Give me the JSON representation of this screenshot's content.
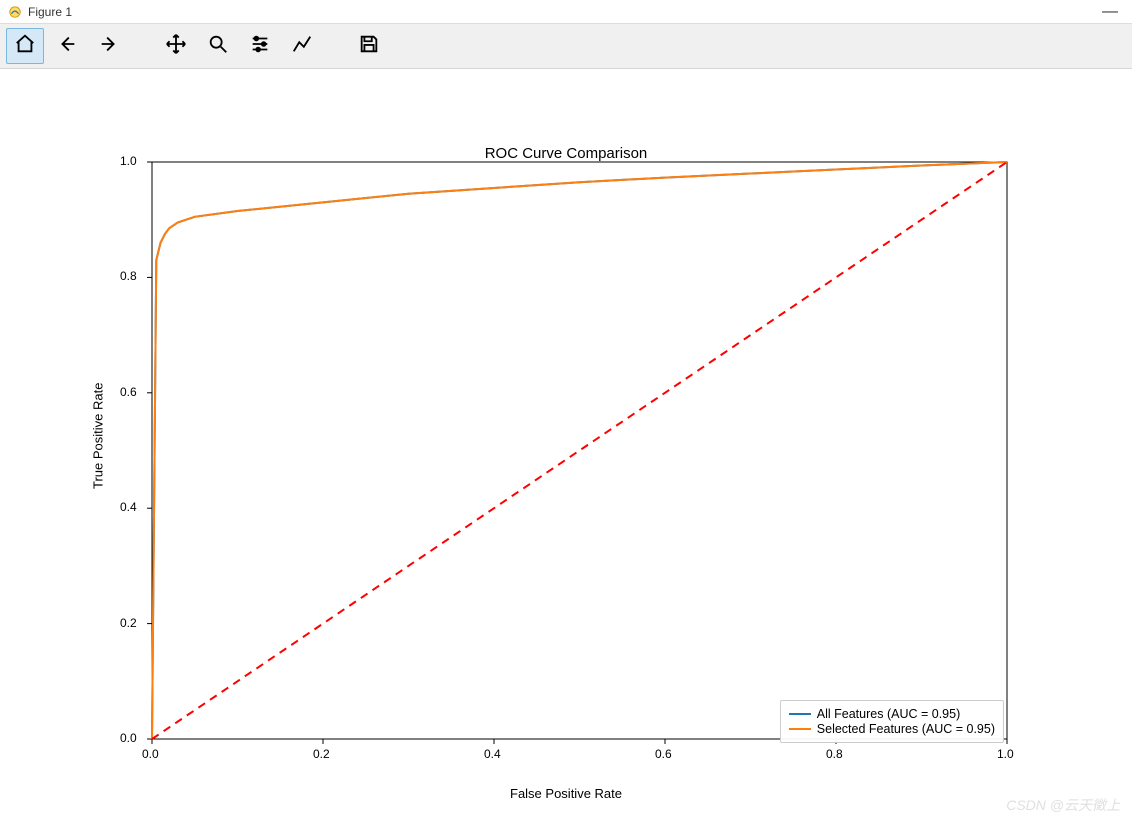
{
  "window": {
    "title": "Figure 1"
  },
  "toolbar": {
    "home": "Home",
    "back": "Back",
    "forward": "Forward",
    "pan": "Pan",
    "zoom": "Zoom",
    "configure": "Configure subplots",
    "edit": "Edit axes",
    "save": "Save"
  },
  "watermark": "CSDN @云天徵上",
  "chart_data": {
    "type": "line",
    "title": "ROC Curve Comparison",
    "xlabel": "False Positive Rate",
    "ylabel": "True Positive Rate",
    "xlim": [
      0.0,
      1.0
    ],
    "ylim": [
      0.0,
      1.0
    ],
    "xticks": [
      0.0,
      0.2,
      0.4,
      0.6,
      0.8,
      1.0
    ],
    "yticks": [
      0.0,
      0.2,
      0.4,
      0.6,
      0.8,
      1.0
    ],
    "series": [
      {
        "name": "All Features (AUC = 0.95)",
        "color": "#1f77b4",
        "style": "solid",
        "x": [
          0.0,
          0.005,
          0.01,
          0.015,
          0.02,
          0.03,
          0.05,
          0.1,
          0.2,
          0.3,
          0.4,
          0.5,
          0.6,
          0.7,
          0.8,
          0.9,
          1.0
        ],
        "y": [
          0.0,
          0.83,
          0.86,
          0.875,
          0.885,
          0.895,
          0.905,
          0.915,
          0.93,
          0.945,
          0.955,
          0.965,
          0.973,
          0.98,
          0.987,
          0.994,
          1.0
        ]
      },
      {
        "name": "Selected Features (AUC = 0.95)",
        "color": "#ff7f0e",
        "style": "solid",
        "x": [
          0.0,
          0.005,
          0.01,
          0.015,
          0.02,
          0.03,
          0.05,
          0.1,
          0.2,
          0.3,
          0.4,
          0.5,
          0.6,
          0.7,
          0.8,
          0.9,
          1.0
        ],
        "y": [
          0.0,
          0.83,
          0.86,
          0.875,
          0.885,
          0.895,
          0.905,
          0.915,
          0.93,
          0.945,
          0.955,
          0.965,
          0.973,
          0.98,
          0.987,
          0.994,
          1.0
        ]
      },
      {
        "name": "diagonal",
        "color": "#ff0000",
        "style": "dashed",
        "legend": false,
        "x": [
          0.0,
          1.0
        ],
        "y": [
          0.0,
          1.0
        ]
      }
    ],
    "legend": {
      "position": "lower right",
      "entries": [
        {
          "label": "All Features (AUC = 0.95)",
          "color": "#1f77b4"
        },
        {
          "label": "Selected Features (AUC = 0.95)",
          "color": "#ff7f0e"
        }
      ]
    }
  }
}
